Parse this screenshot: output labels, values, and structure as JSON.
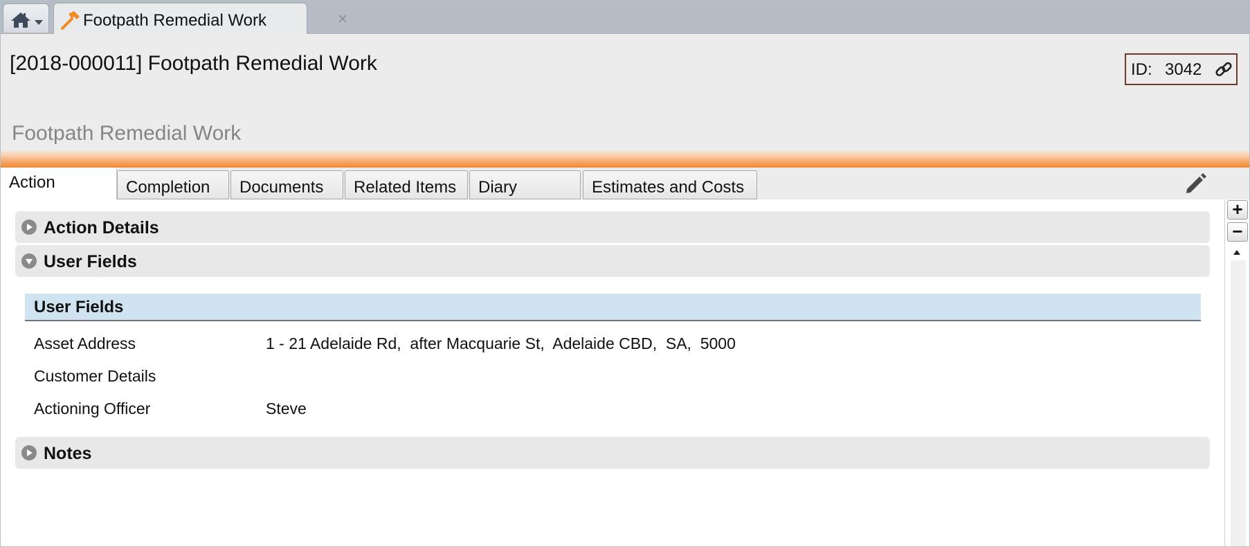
{
  "tabstrip": {
    "home_icon": "home-icon",
    "dropdown_icon": "chevron-down-icon",
    "doc_tab": {
      "icon": "hammer-icon",
      "title": "Footpath Remedial Work",
      "close_label": "×"
    }
  },
  "header": {
    "title": "[2018-000011] Footpath Remedial Work",
    "id_label": "ID:",
    "id_value": "3042",
    "link_icon": "link-icon",
    "subtitle": "Footpath Remedial Work"
  },
  "tabs": [
    {
      "label": "Action",
      "active": true
    },
    {
      "label": "Completion",
      "active": false
    },
    {
      "label": "Documents",
      "active": false
    },
    {
      "label": "Related Items",
      "active": false
    },
    {
      "label": "Diary",
      "active": false
    },
    {
      "label": "Estimates and Costs",
      "active": false
    }
  ],
  "edit_icon": "pencil-icon",
  "sections": [
    {
      "label": "Action Details",
      "expanded": false
    },
    {
      "label": "User Fields",
      "expanded": true
    },
    {
      "label": "Notes",
      "expanded": false
    }
  ],
  "user_fields": {
    "panel_title": "User Fields",
    "rows": [
      {
        "label": "Asset Address",
        "value": "1 - 21 Adelaide Rd,  after Macquarie St,  Adelaide CBD,  SA,  5000"
      },
      {
        "label": "Customer Details",
        "value": ""
      },
      {
        "label": "Actioning Officer",
        "value": "Steve"
      }
    ]
  },
  "rail": {
    "expand_label": "+",
    "collapse_label": "−"
  },
  "colors": {
    "accent_orange": "#ee8a36",
    "panel_blue": "#d0e3f1",
    "id_border": "#6b3a2e"
  }
}
